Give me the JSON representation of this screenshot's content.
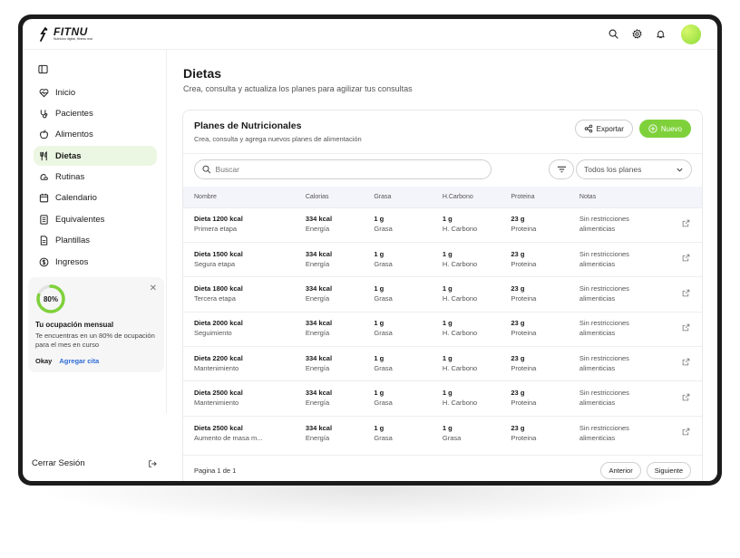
{
  "header": {
    "brand": "FITNU",
    "tagline": "Nutrición digital, fitness real."
  },
  "sidebar": {
    "items": [
      {
        "label": "Inicio",
        "icon": "heart-pulse-icon"
      },
      {
        "label": "Pacientes",
        "icon": "stethoscope-icon"
      },
      {
        "label": "Alimentos",
        "icon": "apple-icon"
      },
      {
        "label": "Dietas",
        "icon": "utensils-icon",
        "active": true
      },
      {
        "label": "Rutinas",
        "icon": "dumbbell-icon"
      },
      {
        "label": "Calendario",
        "icon": "calendar-icon"
      },
      {
        "label": "Equivalentes",
        "icon": "list-icon"
      },
      {
        "label": "Plantillas",
        "icon": "document-icon"
      },
      {
        "label": "Ingresos",
        "icon": "dollar-icon"
      }
    ],
    "occupancy": {
      "percent_label": "80%",
      "fraction": 0.8,
      "title": "Tu ocupación mensual",
      "description": "Te encuentras en un 80% de ocupación para el mes en curso",
      "okay": "Okay",
      "add": "Agregar cita"
    },
    "logout": "Cerrar Sesión"
  },
  "page": {
    "title": "Dietas",
    "subtitle": "Crea, consulta y actualiza los planes para agilizar tus consultas"
  },
  "card": {
    "title": "Planes de Nutricionales",
    "subtitle": "Crea, consulta y agrega nuevos planes de alimentación",
    "export": "Exportar",
    "new": "Nuevo",
    "search_placeholder": "Buscar",
    "select_value": "Todos los planes"
  },
  "table": {
    "headers": {
      "name": "Nombre",
      "calories": "Calorias",
      "fat": "Grasa",
      "carbs": "H.Carbono",
      "protein": "Proteina",
      "notes": "Notas"
    },
    "rows": [
      {
        "name": "Dieta 1200 kcal",
        "stage": "Primera etapa",
        "kcal": "334 kcal",
        "kcal_l": "Energía",
        "fat": "1 g",
        "fat_l": "Grasa",
        "carb": "1 g",
        "carb_l": "H. Carbono",
        "prot": "23 g",
        "prot_l": "Proteina",
        "note1": "Sin restricciones",
        "note2": "alimenticias"
      },
      {
        "name": "Dieta 1500 kcal",
        "stage": "Segura etapa",
        "kcal": "334 kcal",
        "kcal_l": "Energía",
        "fat": "1 g",
        "fat_l": "Grasa",
        "carb": "1 g",
        "carb_l": "H. Carbono",
        "prot": "23 g",
        "prot_l": "Proteina",
        "note1": "Sin restricciones",
        "note2": "alimenticias"
      },
      {
        "name": "Dieta 1800 kcal",
        "stage": "Tercera etapa",
        "kcal": "334 kcal",
        "kcal_l": "Energía",
        "fat": "1 g",
        "fat_l": "Grasa",
        "carb": "1 g",
        "carb_l": "H. Carbono",
        "prot": "23 g",
        "prot_l": "Proteina",
        "note1": "Sin restricciones",
        "note2": "alimenticias"
      },
      {
        "name": "Dieta 2000 kcal",
        "stage": "Seguimiento",
        "kcal": "334 kcal",
        "kcal_l": "Energía",
        "fat": "1 g",
        "fat_l": "Grasa",
        "carb": "1 g",
        "carb_l": "H. Carbono",
        "prot": "23 g",
        "prot_l": "Proteina",
        "note1": "Sin restricciones",
        "note2": "alimenticias"
      },
      {
        "name": "Dieta 2200 kcal",
        "stage": "Mantenimiento",
        "kcal": "334 kcal",
        "kcal_l": "Energía",
        "fat": "1 g",
        "fat_l": "Grasa",
        "carb": "1 g",
        "carb_l": "H. Carbono",
        "prot": "23 g",
        "prot_l": "Proteina",
        "note1": "Sin restricciones",
        "note2": "alimenticias"
      },
      {
        "name": "Dieta 2500 kcal",
        "stage": "Mantenimiento",
        "kcal": "334 kcal",
        "kcal_l": "Energía",
        "fat": "1 g",
        "fat_l": "Grasa",
        "carb": "1 g",
        "carb_l": "H. Carbono",
        "prot": "23 g",
        "prot_l": "Proteina",
        "note1": "Sin restricciones",
        "note2": "alimenticias"
      },
      {
        "name": "Dieta 2500 kcal",
        "stage": "Aumento de masa m...",
        "kcal": "334 kcal",
        "kcal_l": "Energía",
        "fat": "1 g",
        "fat_l": "Grasa",
        "carb": "1 g",
        "carb_l": "Grasa",
        "prot": "23 g",
        "prot_l": "Proteina",
        "note1": "Sin restricciones",
        "note2": "alimenticias"
      }
    ]
  },
  "pagination": {
    "text": "Pagina 1 de 1",
    "prev": "Anterior",
    "next": "Siguiente"
  },
  "colors": {
    "accent": "#7fd13b",
    "active_bg": "#ecf7e3",
    "link": "#2e6bd8"
  }
}
